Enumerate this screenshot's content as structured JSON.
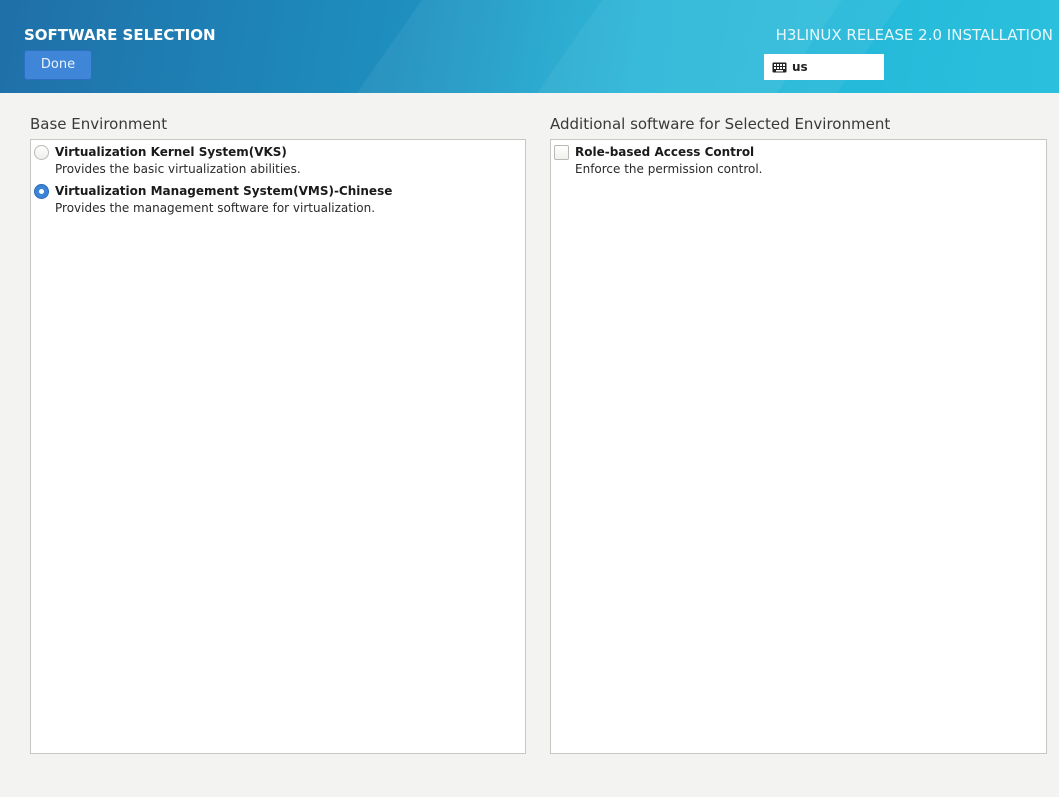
{
  "header": {
    "title": "SOFTWARE SELECTION",
    "done_label": "Done",
    "product": "H3LINUX RELEASE 2.0 INSTALLATION",
    "keyboard_layout": "us"
  },
  "base_environment": {
    "heading": "Base Environment",
    "options": [
      {
        "label": "Virtualization Kernel System(VKS)",
        "description": "Provides the basic virtualization abilities.",
        "selected": false
      },
      {
        "label": "Virtualization Management System(VMS)-Chinese",
        "description": "Provides the management software for virtualization.",
        "selected": true
      }
    ]
  },
  "additional_software": {
    "heading": "Additional software for Selected Environment",
    "options": [
      {
        "label": "Role-based Access Control",
        "description": "Enforce the permission control.",
        "checked": false
      }
    ]
  },
  "colors": {
    "accent": "#3c84d6",
    "header_start": "#1f6fa8",
    "header_end": "#2ac0dd"
  },
  "icons": {
    "keyboard": "keyboard-icon",
    "radio": "radio-button",
    "checkbox": "checkbox"
  }
}
